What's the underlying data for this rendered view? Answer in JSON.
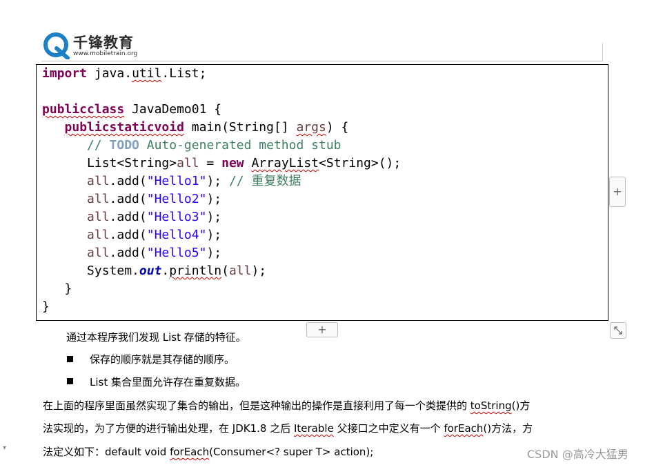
{
  "header": {
    "logo_cn": "千锋教育",
    "logo_url": "www.mobiletrain.org"
  },
  "code": {
    "l1_kw": "import",
    "l1_a": " java.",
    "l1_util": "util",
    "l1_b": ".List;",
    "l3_kw": "publicclass",
    "l3_rest": " JavaDemo01 {",
    "l4_kw": "publicstaticvoid",
    "l4_a": " main(String[] ",
    "l4_args": "args",
    "l4_b": ") {",
    "l5_slashes": "// ",
    "l5_todo": "TODO",
    "l5_rest": " Auto-generated method stub",
    "l6_a": "List<String>",
    "l6_all": "all",
    "l6_b": " = ",
    "l6_kw": "new",
    "l6_c": " ",
    "l6_arraylist": "ArrayList",
    "l6_d": "<String>();",
    "add_all": "all",
    "add_open": ".add(",
    "add_close": ");",
    "hello1": "\"Hello1\"",
    "hello1_comment": " // 重复数据",
    "hello2": "\"Hello2\"",
    "hello3": "\"Hello3\"",
    "hello4": "\"Hello4\"",
    "hello5": "\"Hello5\"",
    "l12_a": "System.",
    "l12_out": "out",
    "l12_b": ".",
    "l12_println": "println",
    "l12_c": "(",
    "l12_all": "all",
    "l12_d": ");",
    "l13": "}",
    "l14": "}"
  },
  "widgets": {
    "plus_side": "+",
    "plus_bottom": "+",
    "resize_glyph": "⤡",
    "side_mark": "▾"
  },
  "text": {
    "intro": "通过本程序我们发现  List  存储的特征。",
    "bullet1": "保存的顺序就是其存储的顺序。",
    "bullet2": "List 集合里面允许存在重复数据。",
    "p1_a": "在上面的程序里面虽然实现了集合的输出，但是这种输出的操作是直接利用了每一个类提供的 ",
    "p1_tostring": "toString",
    "p1_b": "()方",
    "p2_a": "法实现的，为了方便的进行输出处理，在  JDK1.8  之后  ",
    "p2_iterable": "Iterable",
    "p2_b": "  父接口之中定义有一个  ",
    "p2_foreach": "forEach",
    "p2_c": "()方法，方",
    "p3_a": "法定义如下：default void ",
    "p3_foreach": "forEach",
    "p3_b": "(Consumer<? super T> action);"
  },
  "watermark": "CSDN @高冷大猛男",
  "colors": {
    "keyword": "#7f0055",
    "comment": "#3f7f5f",
    "string": "#2a00ff",
    "field": "#0000c0",
    "local_var": "#6a3e3e",
    "logo_blue": "#1d7fc4"
  }
}
